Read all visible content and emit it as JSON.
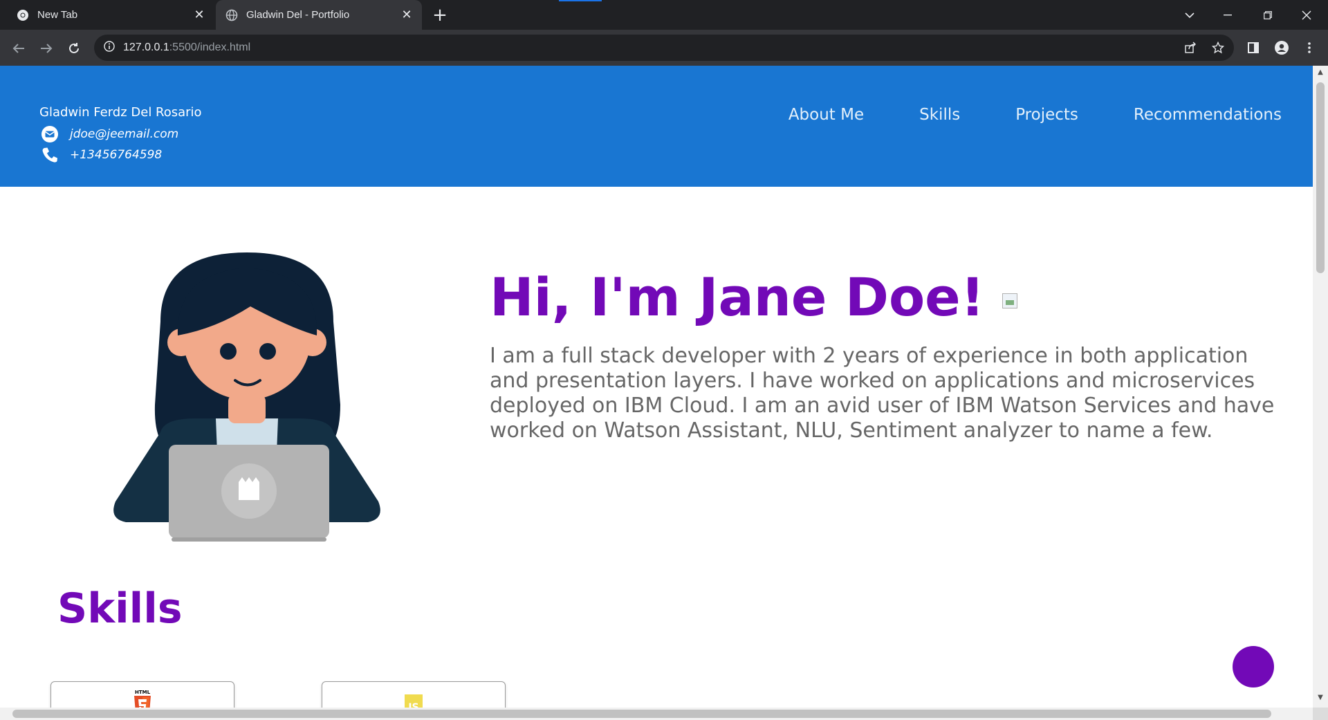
{
  "browser": {
    "tabs": [
      {
        "title": "New Tab",
        "active": false
      },
      {
        "title": "Gladwin Del - Portfolio",
        "active": true
      }
    ],
    "url_host": "127.0.0.1",
    "url_path": ":5500/index.html"
  },
  "header": {
    "name": "Gladwin Ferdz Del Rosario",
    "email": "jdoe@jeemail.com",
    "phone": "+13456764598",
    "nav": [
      "About Me",
      "Skills",
      "Projects",
      "Recommendations"
    ],
    "bg_color": "#1976d2"
  },
  "hero": {
    "title": "Hi, I'm Jane Doe!",
    "description": "I am a full stack developer with 2 years of experience in both application and presentation layers. I have worked on applications and microservices deployed on IBM Cloud. I am an avid user of IBM Watson Services and have worked on Watson Assistant, NLU, Sentiment analyzer to name a few.",
    "accent_color": "#7209b7"
  },
  "skills": {
    "title": "Skills",
    "cards": [
      {
        "icon": "html5-icon",
        "logo_text": "HTML"
      },
      {
        "icon": "javascript-icon",
        "logo_text": "JS"
      }
    ]
  }
}
